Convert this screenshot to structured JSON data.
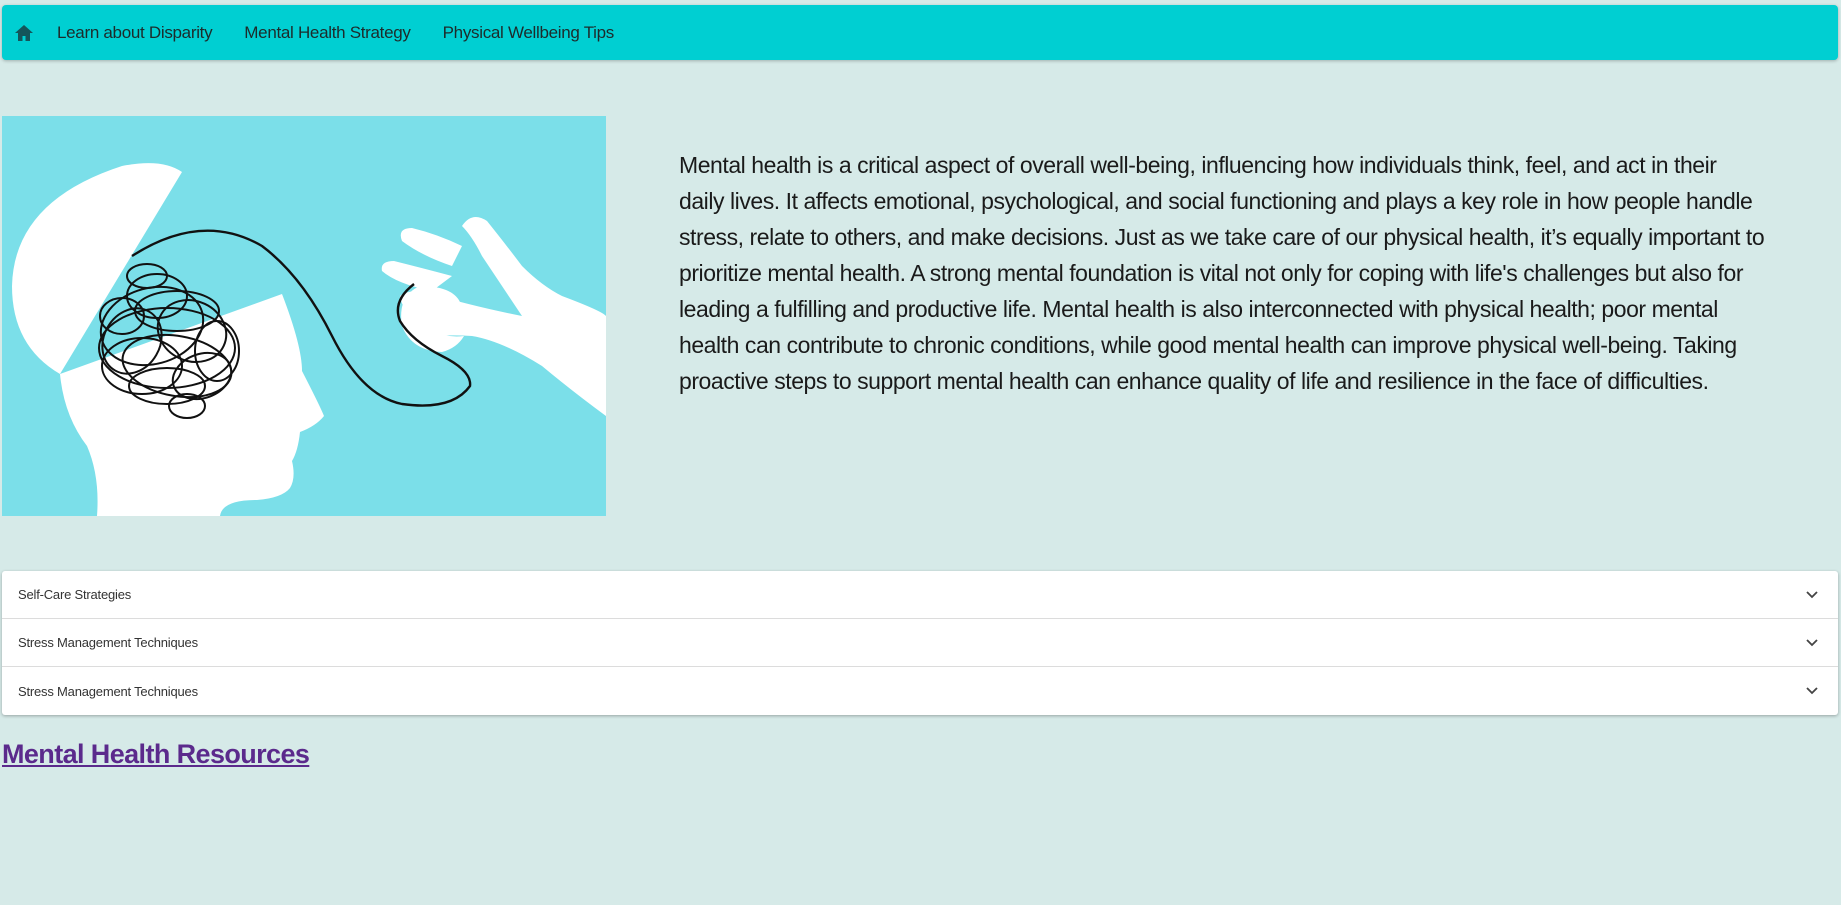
{
  "nav": {
    "home_icon": "home-icon",
    "links": [
      "Learn about Disparity",
      "Mental Health Strategy",
      "Physical Wellbeing Tips"
    ]
  },
  "hero": {
    "image_subject": "head-with-tangled-thoughts-illustration",
    "text": "Mental health is a critical aspect of overall well-being, influencing how individuals think, feel, and act in their daily lives. It affects emotional, psychological, and social functioning and plays a key role in how people handle stress, relate to others, and make decisions. Just as we take care of our physical health, it’s equally important to prioritize mental health. A strong mental foundation is vital not only for coping with life's challenges but also for leading a fulfilling and productive life. Mental health is also interconnected with physical health; poor mental health can contribute to chronic conditions, while good mental health can improve physical well-being. Taking proactive steps to support mental health can enhance quality of life and resilience in the face of difficulties."
  },
  "accordion": {
    "items": [
      "Self-Care Strategies",
      "Stress Management Techniques",
      "Stress Management Techniques"
    ]
  },
  "resources_link": "Mental Health Resources",
  "colors": {
    "navbar": "#00cfd2",
    "background": "#d6eae8",
    "image_background": "#7bdfe9",
    "link": "#5b2a8c"
  }
}
